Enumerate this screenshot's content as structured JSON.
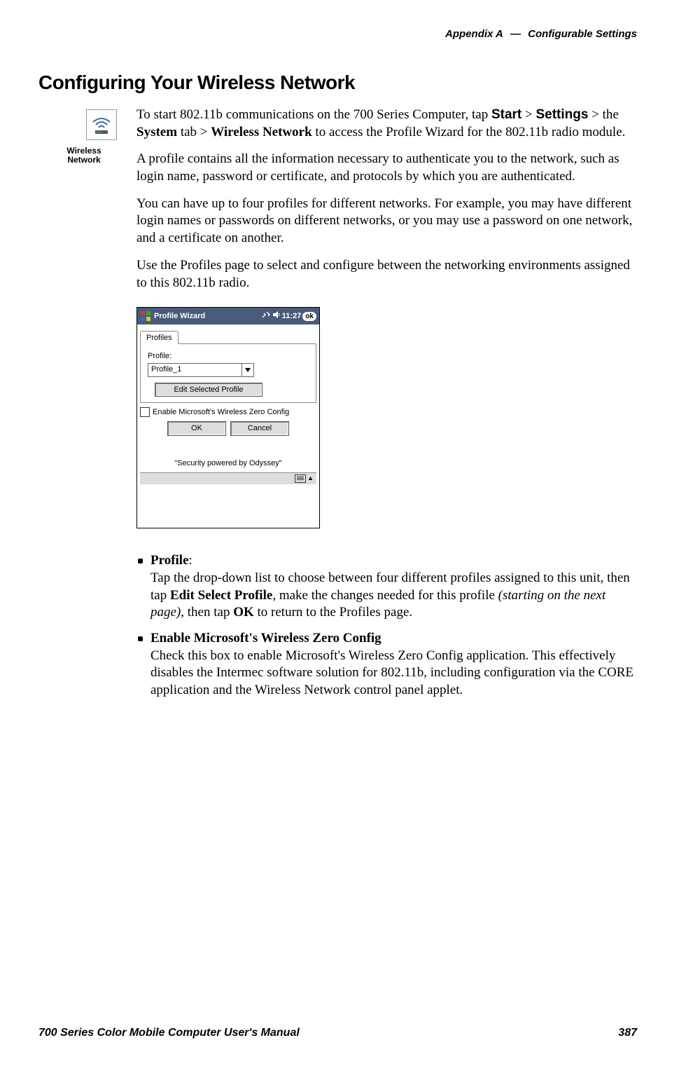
{
  "header": {
    "appendix": "Appendix A",
    "separator": "—",
    "title": "Configurable Settings"
  },
  "section_title": "Configuring Your Wireless Network",
  "icon": {
    "name": "wireless-network-icon",
    "label": "Wireless Network"
  },
  "paragraphs": {
    "p1_a": "To start 802.11b communications on the 700 Series Computer, tap ",
    "p1_start": "Start",
    "p1_b": " > ",
    "p1_settings": "Settings",
    "p1_c": " > the ",
    "p1_system": "System",
    "p1_d": " tab > ",
    "p1_wn": "Wireless Network",
    "p1_e": " to access the Profile Wizard for the 802.11b radio module.",
    "p2": "A profile contains all the information necessary to authenticate you to the network, such as login name, password or certificate, and protocols by which you are authenticated.",
    "p3": "You can have up to four profiles for different networks. For example, you may have different login names or passwords on different networks, or you may use a password on one network, and a certificate on another.",
    "p4": "Use the Profiles page to select and configure between the networking environments assigned to this 802.11b radio."
  },
  "screenshot": {
    "window_title": "Profile Wizard",
    "clock": "11:27",
    "ok_badge": "ok",
    "tab_label": "Profiles",
    "profile_label": "Profile:",
    "profile_value": "Profile_1",
    "edit_button": "Edit Selected Profile",
    "checkbox_label": "Enable Microsoft's Wireless Zero Config",
    "ok_button": "OK",
    "cancel_button": "Cancel",
    "footer_note": "\"Security powered by Odyssey\""
  },
  "bullets": {
    "b1_title": "Profile",
    "b1_colon": ":",
    "b1_body_a": "Tap the drop-down list to choose between four different profiles assigned to this unit, then tap ",
    "b1_edit": "Edit Select Profile",
    "b1_body_b": ", make the changes needed for this profile ",
    "b1_italic": "(starting on the next page)",
    "b1_body_c": ", then tap ",
    "b1_ok": "OK",
    "b1_body_d": " to return to the Profiles page.",
    "b2_title": "Enable Microsoft's Wireless Zero Config",
    "b2_body": "Check this box to enable Microsoft's Wireless Zero Config application. This effectively disables the Intermec software solution for 802.11b, including configuration via the CORE application and the Wireless Network control panel applet."
  },
  "footer": {
    "manual_title": "700 Series Color Mobile Computer User's Manual",
    "page_number": "387"
  }
}
